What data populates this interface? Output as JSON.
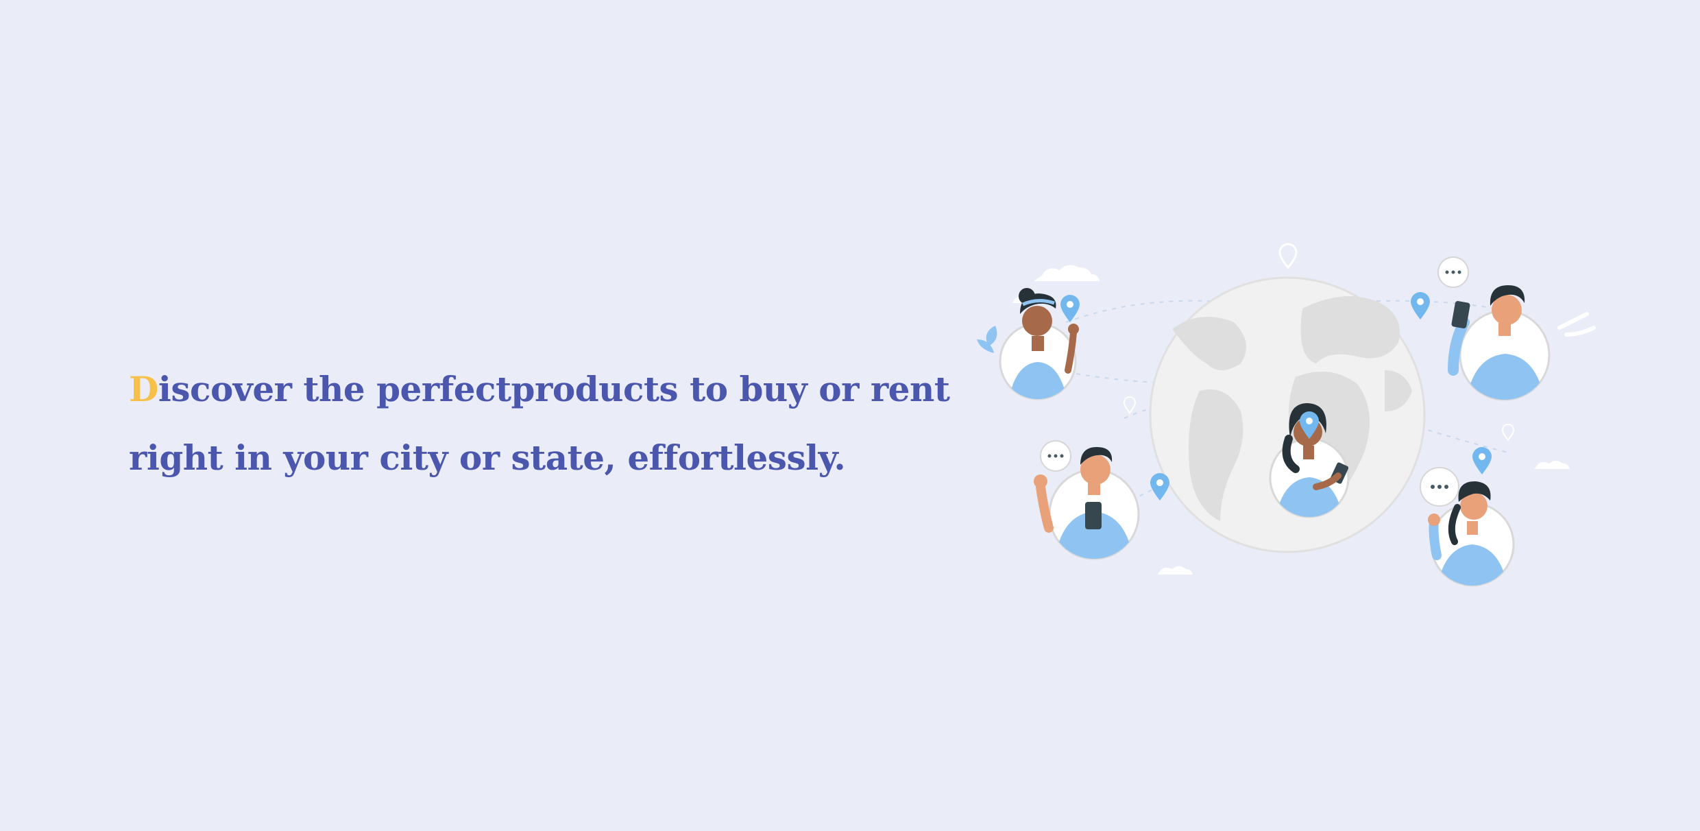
{
  "hero": {
    "headline": {
      "initial": "D",
      "line1_rest": "iscover the perfectproducts to buy or rent",
      "line2": "right in your city or state, effortlessly."
    },
    "colors": {
      "background": "#eaedf8",
      "headline": "#4b56ad",
      "initial_accent": "#f7c048",
      "figure_blue": "#8ec3f2",
      "pin_blue": "#72b7ee",
      "globe_grey": "#dadada",
      "skin_tone": "#e9a17a",
      "hair_dark": "#263238"
    },
    "illustration": {
      "icons": [
        "globe-icon",
        "person-icon",
        "location-pin-icon",
        "speech-bubble-icon",
        "cloud-icon"
      ]
    }
  }
}
